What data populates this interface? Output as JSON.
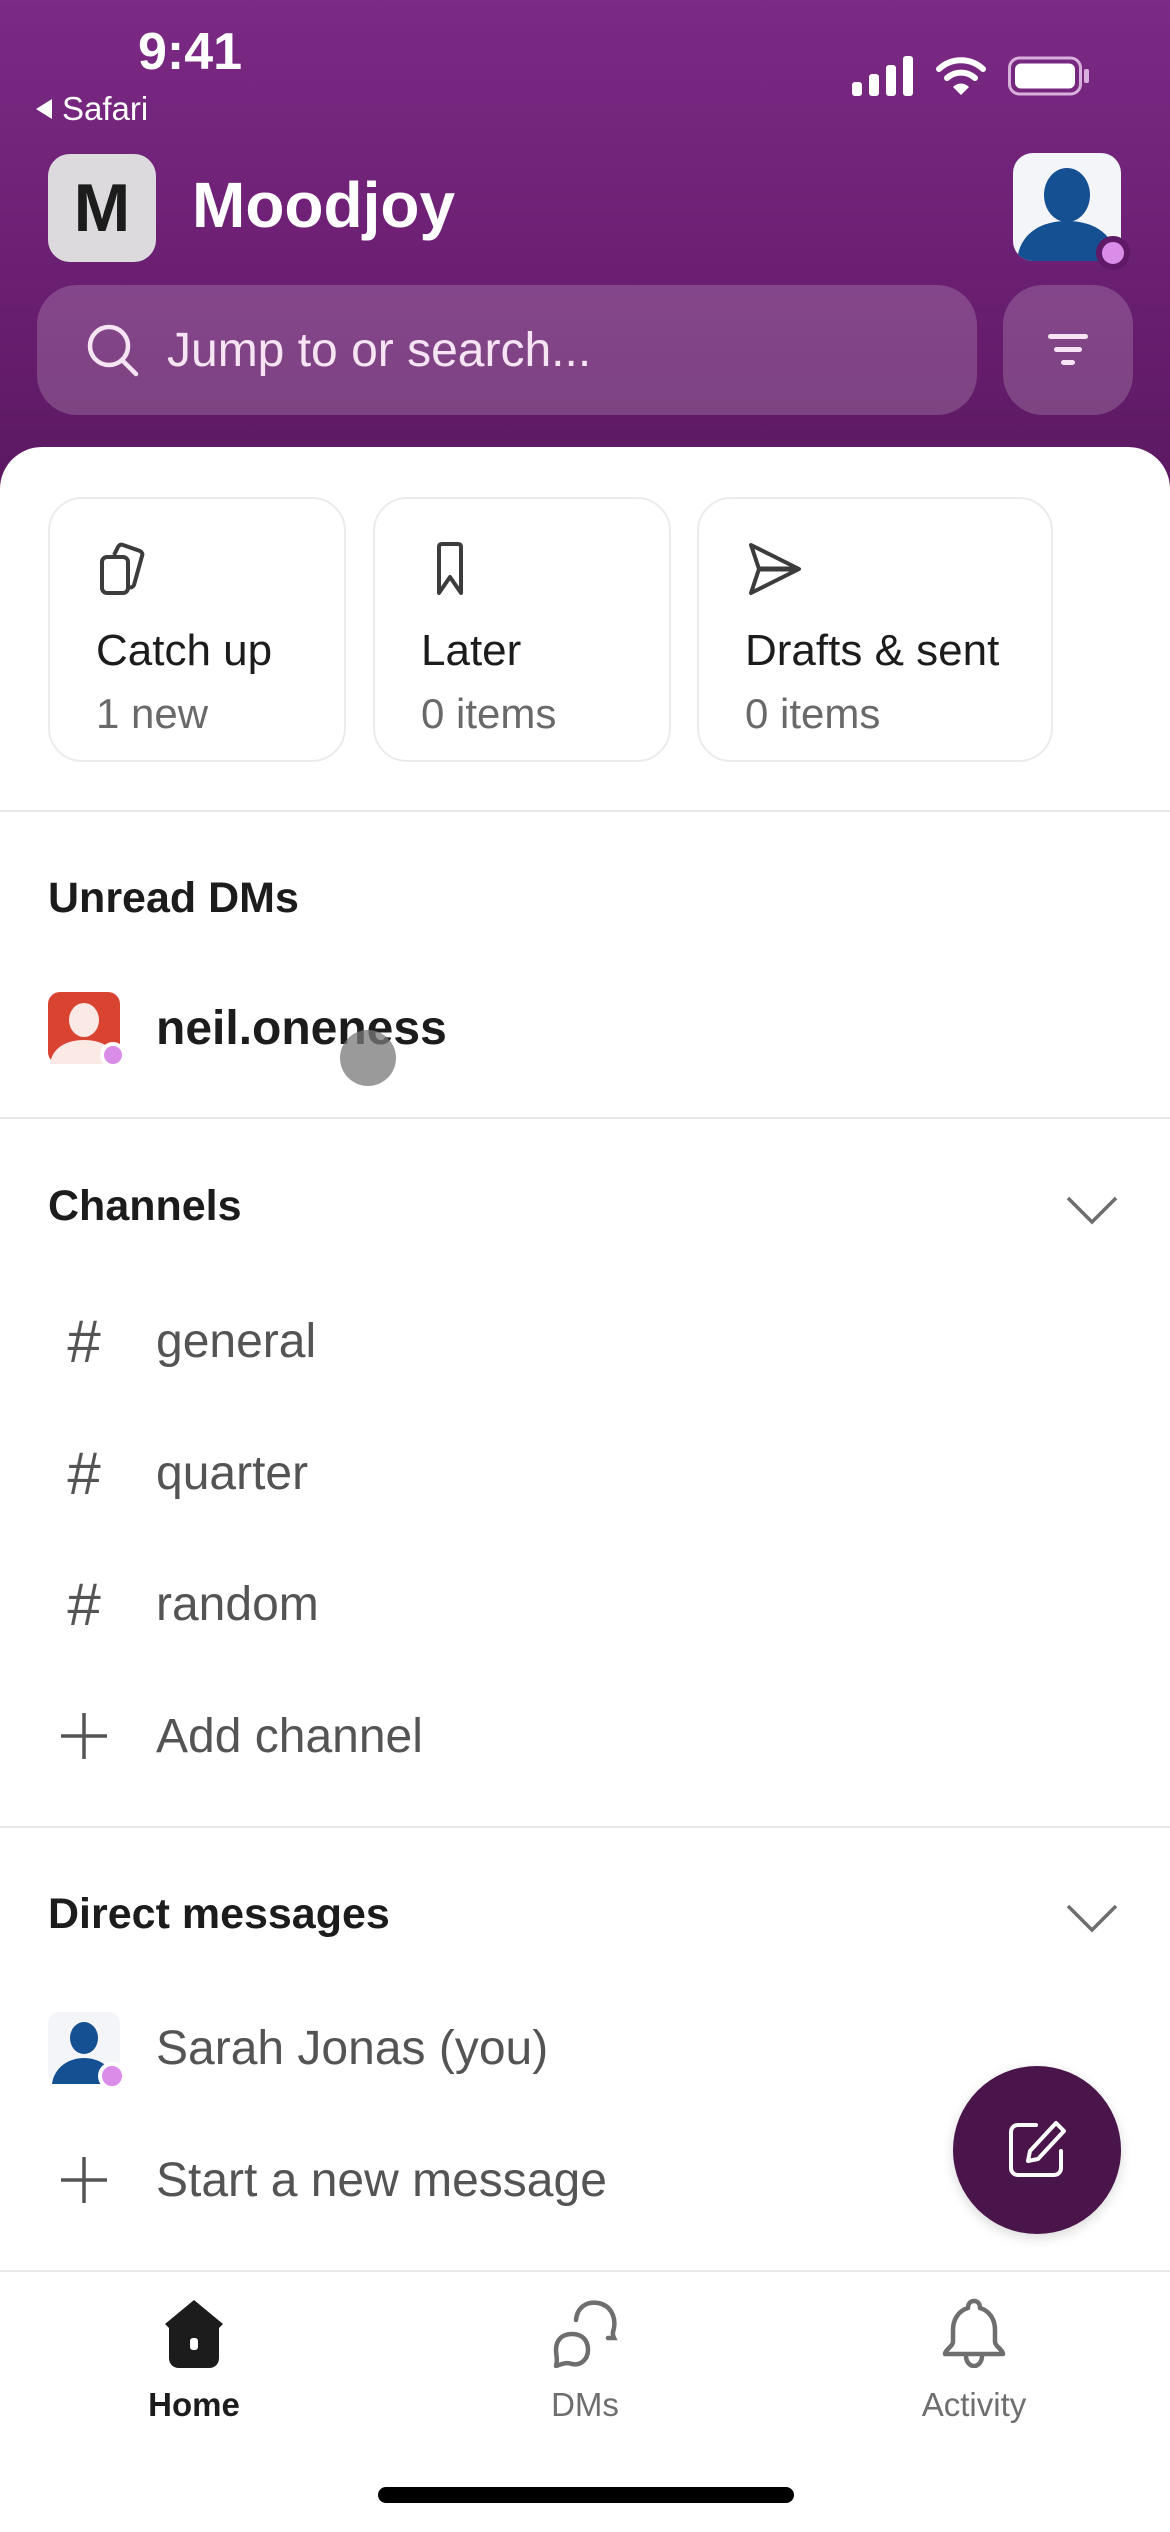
{
  "status_bar": {
    "time": "9:41",
    "back_app": "Safari",
    "icons": [
      "cellular-signal-icon",
      "wifi-icon",
      "battery-icon"
    ]
  },
  "header": {
    "workspace_initial": "M",
    "workspace_name": "Moodjoy",
    "profile_status": "online"
  },
  "search": {
    "placeholder": "Jump to or search..."
  },
  "quick_cards": [
    {
      "icon": "catch-up-icon",
      "title": "Catch up",
      "subtitle": "1 new"
    },
    {
      "icon": "bookmark-icon",
      "title": "Later",
      "subtitle": "0 items"
    },
    {
      "icon": "send-icon",
      "title": "Drafts & sent",
      "subtitle": "0 items"
    }
  ],
  "unread_dms": {
    "title": "Unread DMs",
    "items": [
      {
        "name": "neil.oneness",
        "status": "online"
      }
    ]
  },
  "channels": {
    "title": "Channels",
    "items": [
      {
        "name": "general"
      },
      {
        "name": "quarter"
      },
      {
        "name": "random"
      }
    ],
    "add_label": "Add channel"
  },
  "direct_messages": {
    "title": "Direct messages",
    "items": [
      {
        "name": "Sarah Jonas (you)",
        "status": "online"
      }
    ],
    "new_label": "Start a new message"
  },
  "fab": {
    "icon": "compose-icon"
  },
  "tabs": [
    {
      "label": "Home",
      "icon": "home-icon",
      "active": true
    },
    {
      "label": "DMs",
      "icon": "dms-icon",
      "active": false
    },
    {
      "label": "Activity",
      "icon": "bell-icon",
      "active": false
    }
  ],
  "colors": {
    "header_purple": "#6b1f72",
    "fab_purple": "#4a154b",
    "presence": "#d98ce8",
    "avatar_red": "#d94432",
    "avatar_blue": "#155092"
  }
}
